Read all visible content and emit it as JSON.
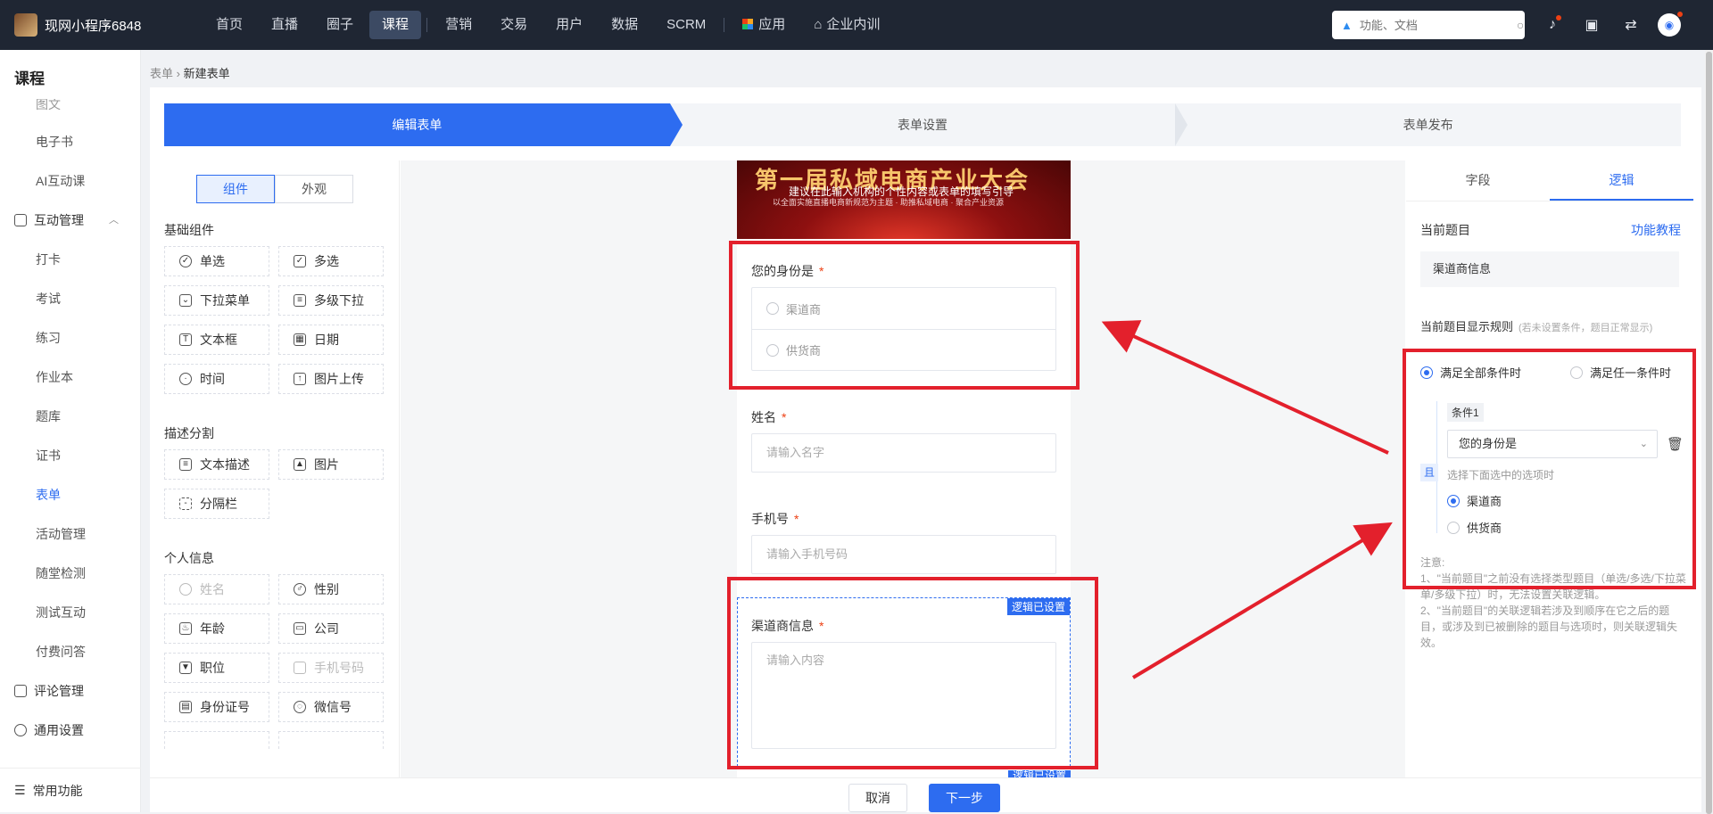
{
  "app": {
    "name": "现网小程序6848"
  },
  "nav": {
    "items": [
      "首页",
      "直播",
      "圈子",
      "课程",
      "营销",
      "交易",
      "用户",
      "数据",
      "SCRM"
    ],
    "active": "课程",
    "apps": "应用",
    "training": "企业内训"
  },
  "search": {
    "placeholder": "功能、文档"
  },
  "sidebar": {
    "title": "课程",
    "top_cut": "图文",
    "items_a": [
      "电子书",
      "AI互动课"
    ],
    "group1": "互动管理",
    "items_b": [
      "打卡",
      "考试",
      "练习",
      "作业本",
      "题库",
      "证书",
      "表单",
      "活动管理",
      "随堂检测",
      "测试互动",
      "付费问答"
    ],
    "active": "表单",
    "group2": "评论管理",
    "group3": "通用设置",
    "bottom": "常用功能"
  },
  "breadcrumb": {
    "parent": "表单",
    "current": "新建表单"
  },
  "steps": [
    "编辑表单",
    "表单设置",
    "表单发布"
  ],
  "left": {
    "tabs": [
      "组件",
      "外观"
    ],
    "sec1": "基础组件",
    "basic": [
      "单选",
      "多选",
      "下拉菜单",
      "多级下拉",
      "文本框",
      "日期",
      "时间",
      "图片上传"
    ],
    "sec2": "描述分割",
    "desc": [
      "文本描述",
      "图片",
      "分隔栏"
    ],
    "sec3": "个人信息",
    "personal": [
      "姓名",
      "性别",
      "年龄",
      "公司",
      "职位",
      "手机号码",
      "身份证号",
      "微信号"
    ]
  },
  "form": {
    "banner_title": "第一届私域电商产业大会",
    "banner_sub": "建议在此输入机构的个性内容或表单的填写引导",
    "banner_small": "以全面实施直播电商新规范为主题 · 助推私域电商 · 聚合产业资源",
    "q1": "您的身份是",
    "q1_opts": [
      "渠道商",
      "供货商"
    ],
    "q2": "姓名",
    "q2_ph": "请输入名字",
    "q3": "手机号",
    "q3_ph": "请输入手机号码",
    "q4": "渠道商信息",
    "q4_ph": "请输入内容",
    "badge": "逻辑已设置"
  },
  "right": {
    "tabs": [
      "字段",
      "逻辑"
    ],
    "cur_label": "当前题目",
    "tutorial": "功能教程",
    "cur_value": "渠道商信息",
    "rule_label": "当前题目显示规则",
    "rule_hint": "(若未设置条件，题目正常显示)",
    "all": "满足全部条件时",
    "any": "满足任一条件时",
    "cond": "条件1",
    "cond_sel": "您的身份是",
    "and": "且",
    "sub_hint": "选择下面选中的选项时",
    "opts": [
      "渠道商",
      "供货商"
    ],
    "note": "注意:\n1、\"当前题目\"之前没有选择类型题目（单选/多选/下拉菜单/多级下拉）时，无法设置关联逻辑。\n2、\"当前题目\"的关联逻辑若涉及到顺序在它之后的题目，或涉及到已被删除的题目与选项时，则关联逻辑失效。"
  },
  "footer": {
    "cancel": "取消",
    "next": "下一步"
  },
  "colors": {
    "primary": "#2d6cf0",
    "annotation": "#e3202c",
    "topbar": "#1f2633"
  }
}
